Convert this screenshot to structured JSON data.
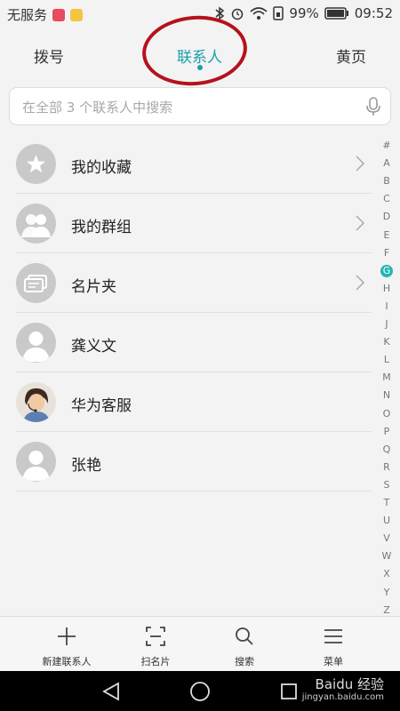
{
  "status_bar": {
    "carrier": "无服务",
    "battery": "99%",
    "time": "09:52"
  },
  "tabs": [
    {
      "label": "拨号"
    },
    {
      "label": "联系人"
    },
    {
      "label": "黄页"
    }
  ],
  "search": {
    "placeholder": "在全部 3 个联系人中搜索"
  },
  "contacts": [
    {
      "label": "我的收藏",
      "icon": "star-icon"
    },
    {
      "label": "我的群组",
      "icon": "group-icon"
    },
    {
      "label": "名片夹",
      "icon": "card-icon"
    },
    {
      "label": "龚义文",
      "icon": "person-avatar"
    },
    {
      "label": "华为客服",
      "icon": "huawei-service-avatar"
    },
    {
      "label": "张艳",
      "icon": "person-avatar"
    }
  ],
  "alphabet": [
    "#",
    "A",
    "B",
    "C",
    "D",
    "E",
    "F",
    "G",
    "H",
    "I",
    "J",
    "K",
    "L",
    "M",
    "N",
    "O",
    "P",
    "Q",
    "R",
    "S",
    "T",
    "U",
    "V",
    "W",
    "X",
    "Y",
    "Z"
  ],
  "alphabet_selected": "G",
  "bottom_bar": [
    {
      "label": "新建联系人",
      "icon": "plus-icon"
    },
    {
      "label": "扫名片",
      "icon": "scan-icon"
    },
    {
      "label": "搜索",
      "icon": "search-icon"
    },
    {
      "label": "菜单",
      "icon": "menu-icon"
    }
  ],
  "watermark": {
    "brand": "Baidu 经验",
    "url": "jingyan.baidu.com"
  },
  "colors": {
    "accent": "#1aa0a8",
    "annotation": "#b5121b",
    "index_highlight": "#25b6b0"
  }
}
